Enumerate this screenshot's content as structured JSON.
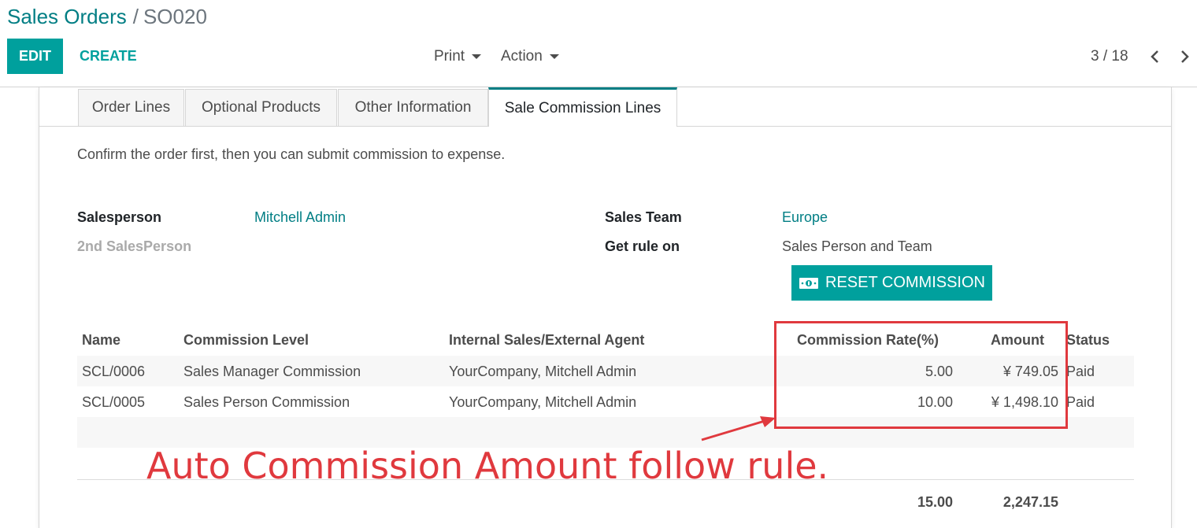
{
  "breadcrumb": {
    "parent": "Sales Orders",
    "separator": "/",
    "current": "SO020"
  },
  "toolbar": {
    "edit_label": "EDIT",
    "create_label": "CREATE",
    "print_label": "Print",
    "action_label": "Action"
  },
  "pager": {
    "value": "3 / 18"
  },
  "tabs": [
    {
      "label": "Order Lines"
    },
    {
      "label": "Optional Products"
    },
    {
      "label": "Other Information"
    },
    {
      "label": "Sale Commission Lines",
      "active": true
    }
  ],
  "notice": "Confirm the order first, then you can submit commission to expense.",
  "fields": {
    "salesperson_label": "Salesperson",
    "salesperson_value": "Mitchell Admin",
    "second_salesperson_label": "2nd SalesPerson",
    "sales_team_label": "Sales Team",
    "sales_team_value": "Europe",
    "get_rule_label": "Get rule on",
    "get_rule_value": "Sales Person and Team"
  },
  "reset_button": {
    "label": "RESET COMMISSION",
    "icon": "money-icon"
  },
  "table": {
    "headers": [
      "Name",
      "Commission Level",
      "Internal Sales/External Agent",
      "Commission Rate(%)",
      "Amount",
      "Status"
    ],
    "rows": [
      [
        "SCL/0006",
        "Sales Manager Commission",
        "YourCompany, Mitchell Admin",
        "5.00",
        "¥ 749.05",
        "Paid"
      ],
      [
        "SCL/0005",
        "Sales Person Commission",
        "YourCompany, Mitchell Admin",
        "10.00",
        "¥ 1,498.10",
        "Paid"
      ]
    ],
    "totals": {
      "rate": "15.00",
      "amount": "2,247.15"
    }
  },
  "annotation": {
    "text": "Auto Commission Amount follow rule.",
    "color": "#e0393e"
  },
  "colors": {
    "brand": "#00a09d",
    "link": "#017e84"
  }
}
